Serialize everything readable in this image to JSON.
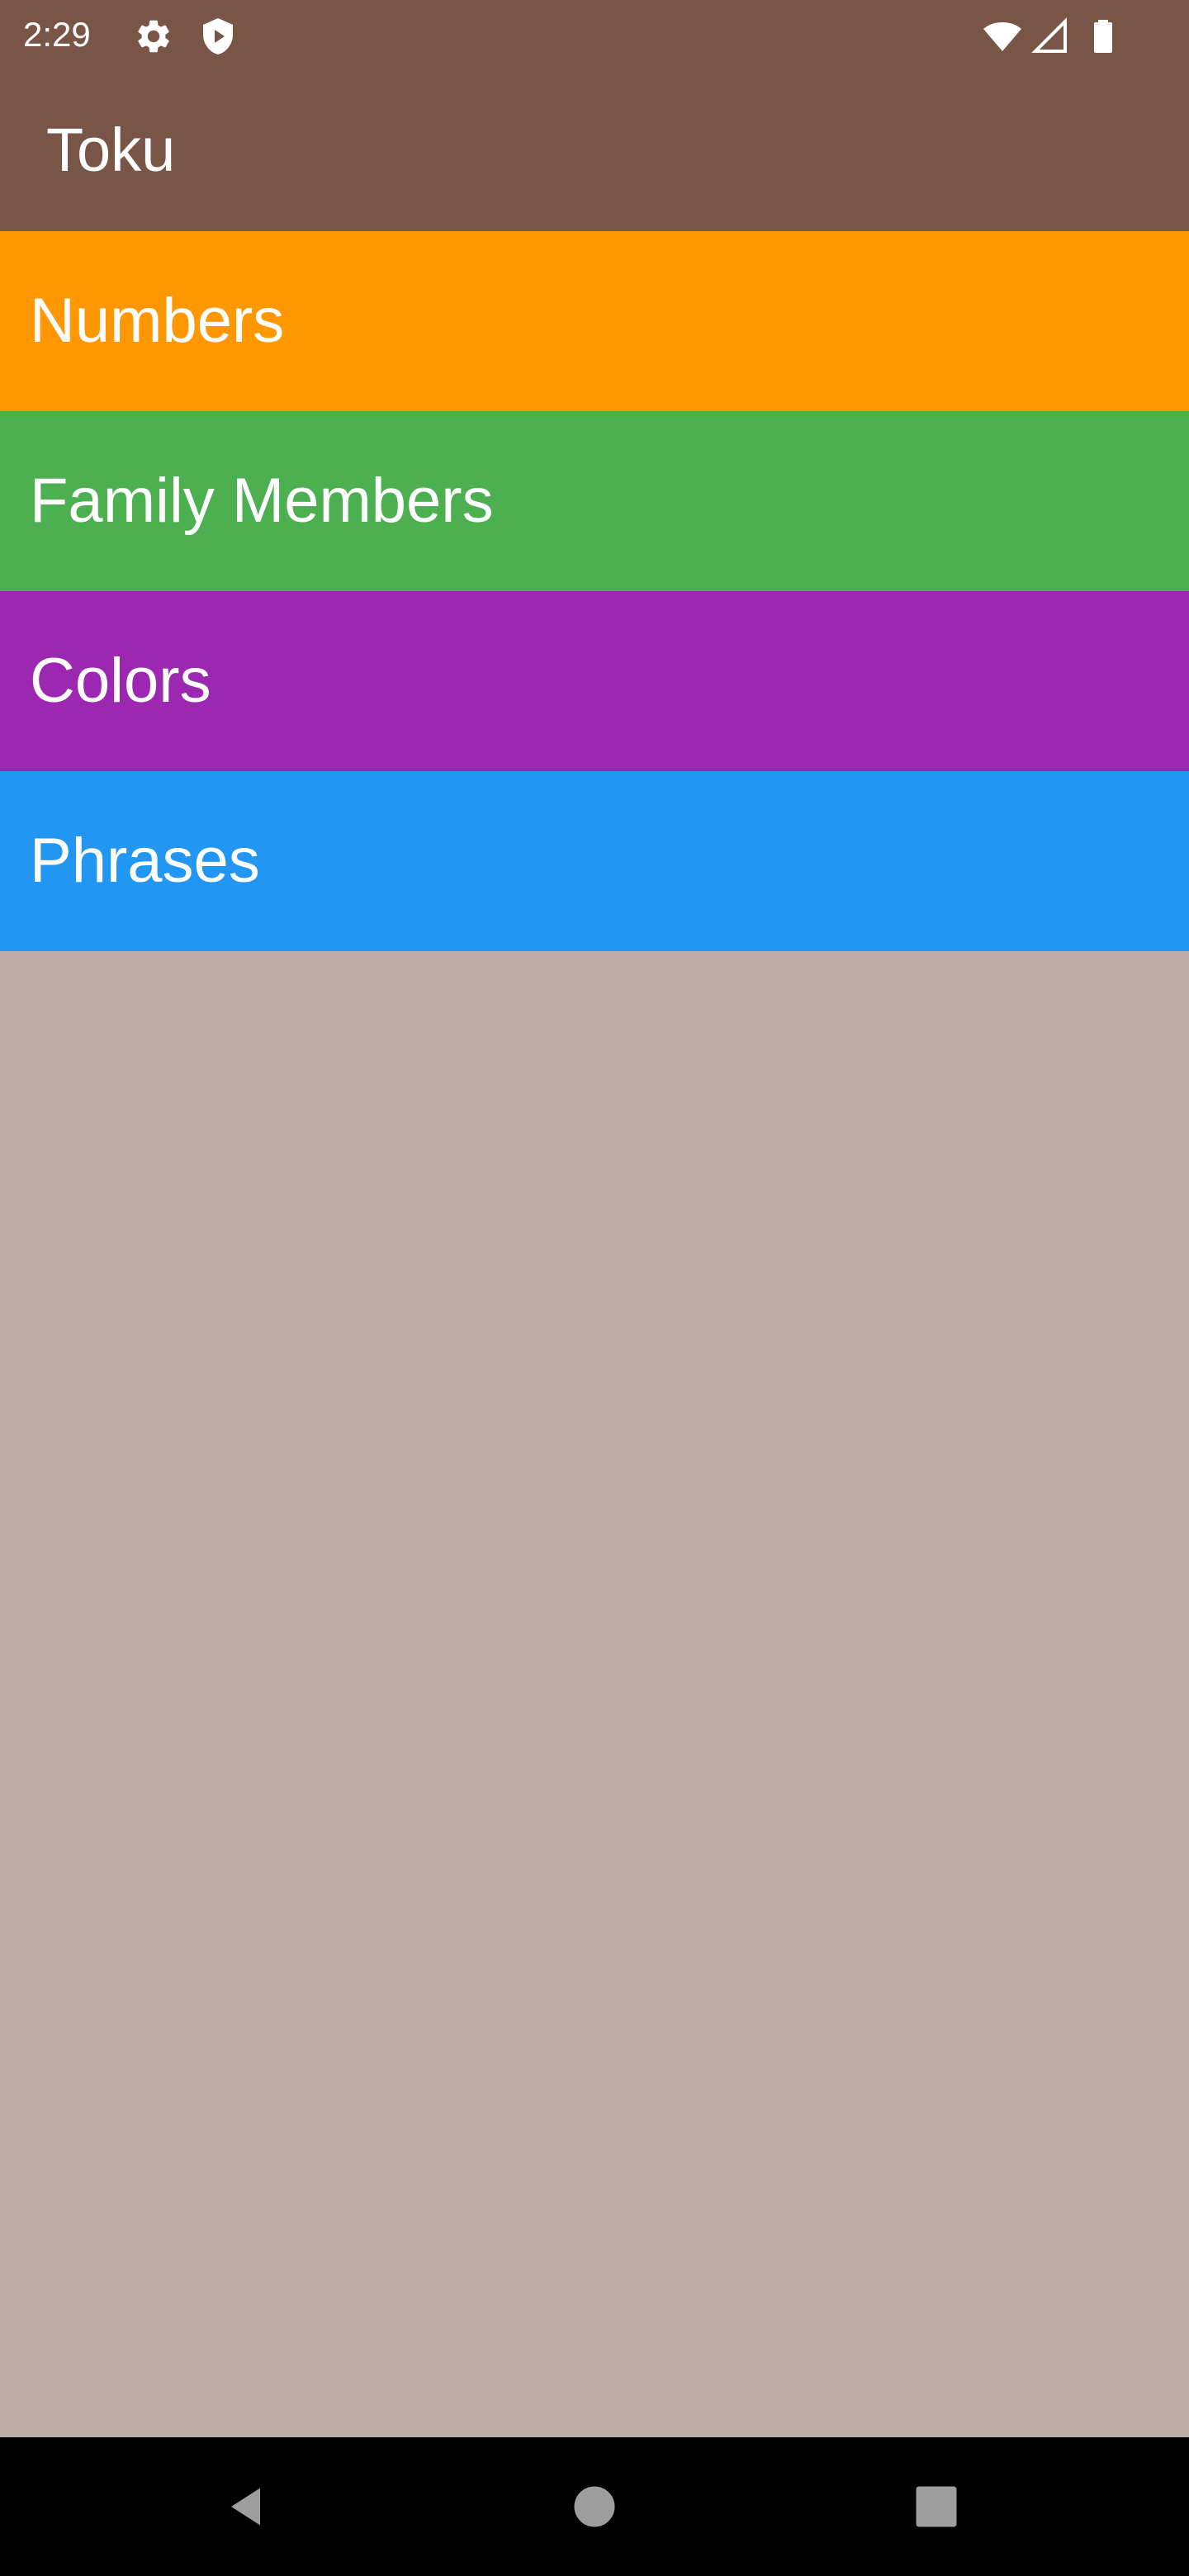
{
  "status_bar": {
    "time": "2:29",
    "icons_left": [
      "gear-icon",
      "shield-play-icon"
    ],
    "icons_right": [
      "wifi-icon",
      "cellular-signal-icon",
      "battery-icon"
    ]
  },
  "app_bar": {
    "title": "Toku",
    "color": "#795548"
  },
  "categories": [
    {
      "label": "Numbers",
      "color": "#FF9800"
    },
    {
      "label": "Family Members",
      "color": "#4CAF50"
    },
    {
      "label": "Colors",
      "color": "#9C27B0"
    },
    {
      "label": "Phrases",
      "color": "#2196F3"
    }
  ],
  "background_color": "#BCABA4",
  "nav_bar": {
    "buttons": [
      "back-icon",
      "home-icon",
      "recents-icon"
    ]
  }
}
